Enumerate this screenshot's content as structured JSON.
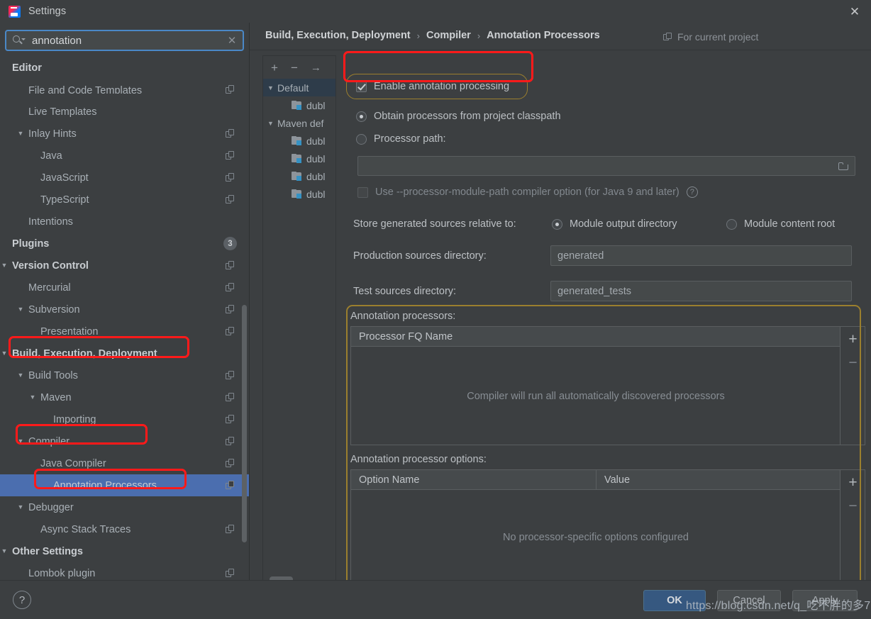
{
  "window": {
    "title": "Settings",
    "logo_icon": "intellij-idea-logo",
    "close_icon": "close-icon"
  },
  "search": {
    "value": "annotation",
    "placeholder": "",
    "icon": "search-icon",
    "clear_icon": "clear-icon"
  },
  "sidebar": {
    "items": [
      {
        "label": "Editor",
        "indent": 0,
        "bold": true,
        "arrow": "",
        "icon": "",
        "clipped": false
      },
      {
        "label": "File and Code Templates",
        "indent": 1,
        "bold": false,
        "arrow": "",
        "icon": "copy-icon",
        "clipped": true
      },
      {
        "label": "Live Templates",
        "indent": 1,
        "bold": false,
        "arrow": "",
        "icon": "",
        "clipped": false
      },
      {
        "label": "Inlay Hints",
        "indent": 1,
        "bold": false,
        "arrow": "▼",
        "icon": "copy-icon",
        "clipped": false
      },
      {
        "label": "Java",
        "indent": 2,
        "bold": false,
        "arrow": "",
        "icon": "copy-icon",
        "clipped": false
      },
      {
        "label": "JavaScript",
        "indent": 2,
        "bold": false,
        "arrow": "",
        "icon": "copy-icon",
        "clipped": false
      },
      {
        "label": "TypeScript",
        "indent": 2,
        "bold": false,
        "arrow": "",
        "icon": "copy-icon",
        "clipped": false
      },
      {
        "label": "Intentions",
        "indent": 1,
        "bold": false,
        "arrow": "",
        "icon": "",
        "clipped": false
      },
      {
        "label": "Plugins",
        "indent": 0,
        "bold": true,
        "arrow": "",
        "icon": "badge",
        "badge": "3"
      },
      {
        "label": "Version Control",
        "indent": 0,
        "bold": true,
        "arrow": "▼",
        "icon": "copy-icon",
        "clipped": false
      },
      {
        "label": "Mercurial",
        "indent": 1,
        "bold": false,
        "arrow": "",
        "icon": "copy-icon",
        "clipped": false
      },
      {
        "label": "Subversion",
        "indent": 1,
        "bold": false,
        "arrow": "▼",
        "icon": "copy-icon",
        "clipped": false
      },
      {
        "label": "Presentation",
        "indent": 2,
        "bold": false,
        "arrow": "",
        "icon": "copy-icon",
        "clipped": false
      },
      {
        "label": "Build, Execution, Deployment",
        "indent": 0,
        "bold": true,
        "arrow": "▼",
        "icon": "",
        "clipped": false
      },
      {
        "label": "Build Tools",
        "indent": 1,
        "bold": false,
        "arrow": "▼",
        "icon": "copy-icon",
        "clipped": false
      },
      {
        "label": "Maven",
        "indent": 2,
        "bold": false,
        "arrow": "▼",
        "icon": "copy-icon",
        "clipped": false
      },
      {
        "label": "Importing",
        "indent": 3,
        "bold": false,
        "arrow": "",
        "icon": "copy-icon",
        "clipped": false
      },
      {
        "label": "Compiler",
        "indent": 1,
        "bold": false,
        "arrow": "▼",
        "icon": "copy-icon",
        "clipped": false
      },
      {
        "label": "Java Compiler",
        "indent": 2,
        "bold": false,
        "arrow": "",
        "icon": "copy-icon",
        "clipped": false
      },
      {
        "label": "Annotation Processors",
        "indent": 3,
        "bold": false,
        "arrow": "",
        "icon": "copy-icon",
        "selected": true
      },
      {
        "label": "Debugger",
        "indent": 1,
        "bold": false,
        "arrow": "▼",
        "icon": "",
        "clipped": false
      },
      {
        "label": "Async Stack Traces",
        "indent": 2,
        "bold": false,
        "arrow": "",
        "icon": "copy-icon",
        "clipped": false
      },
      {
        "label": "Other Settings",
        "indent": 0,
        "bold": true,
        "arrow": "▼",
        "icon": "",
        "clipped": false
      },
      {
        "label": "Lombok plugin",
        "indent": 1,
        "bold": false,
        "arrow": "",
        "icon": "copy-icon",
        "clipped": false
      }
    ]
  },
  "breadcrumb": {
    "parts": [
      "Build, Execution, Deployment",
      "Compiler",
      "Annotation Processors"
    ],
    "separator": "›",
    "scope_label": "For current project",
    "scope_icon": "copy-icon"
  },
  "modules": {
    "toolbar": {
      "add": "+",
      "remove": "−",
      "move": "→"
    },
    "rows": [
      {
        "label": "Default",
        "arrow": "▼",
        "indent": 0,
        "icon": "",
        "highlight": true
      },
      {
        "label": "dubl",
        "arrow": "",
        "indent": 1,
        "icon": "module-icon",
        "highlight": false
      },
      {
        "label": "Maven def",
        "arrow": "▼",
        "indent": 0,
        "icon": "",
        "highlight": false
      },
      {
        "label": "dubl",
        "arrow": "",
        "indent": 1,
        "icon": "module-icon",
        "highlight": false
      },
      {
        "label": "dubl",
        "arrow": "",
        "indent": 1,
        "icon": "module-icon",
        "highlight": false
      },
      {
        "label": "dubl",
        "arrow": "",
        "indent": 1,
        "icon": "module-icon",
        "highlight": false
      },
      {
        "label": "dubl",
        "arrow": "",
        "indent": 1,
        "icon": "module-icon",
        "highlight": false
      }
    ]
  },
  "settings": {
    "enable_annotation_processing": {
      "label": "Enable annotation processing",
      "checked": true
    },
    "source_mode": {
      "obtain_from_classpath": {
        "label": "Obtain processors from project classpath",
        "selected": true
      },
      "processor_path": {
        "label": "Processor path:",
        "selected": false,
        "value": "",
        "browse_icon": "folder-icon"
      }
    },
    "use_processor_module_path": {
      "label": "Use --processor-module-path compiler option (for Java 9 and later)",
      "checked": false,
      "help_icon": "help-icon"
    },
    "store_generated_label": "Store generated sources relative to:",
    "store_options": [
      {
        "label": "Module output directory",
        "selected": true
      },
      {
        "label": "Module content root",
        "selected": false
      }
    ],
    "production_sources": {
      "label": "Production sources directory:",
      "value": "generated"
    },
    "test_sources": {
      "label": "Test sources directory:",
      "value": "generated_tests"
    }
  },
  "processors_table": {
    "caption": "Annotation processors:",
    "columns": [
      "Processor FQ Name"
    ],
    "rows": [],
    "empty_text": "Compiler will run all automatically discovered processors",
    "add_icon": "+",
    "remove_icon": "−"
  },
  "options_table": {
    "caption": "Annotation processor options:",
    "columns": [
      "Option Name",
      "Value"
    ],
    "rows": [],
    "empty_text": "No processor-specific options configured",
    "add_icon": "+",
    "remove_icon": "−"
  },
  "footer": {
    "help_icon": "?",
    "ok": "OK",
    "cancel": "Cancel",
    "apply": "Apply"
  },
  "watermark": {
    "text": "https://blog.csdn.net/q_吃不胖的多7"
  },
  "colors": {
    "background": "#3c3f41",
    "selection": "#4b6eaf",
    "accent_focus": "#4a88c7",
    "annotation_red": "#ff1a1a",
    "focus_gold": "#9b7f2e",
    "primary_button": "#365880"
  }
}
